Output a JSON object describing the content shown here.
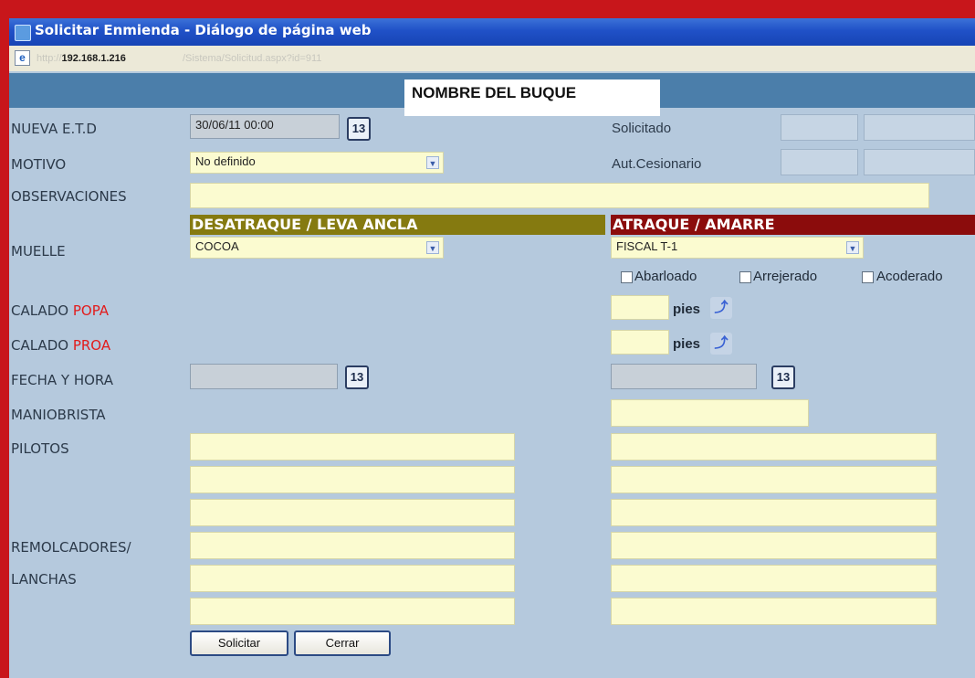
{
  "window": {
    "title": "Solicitar Enmienda - Diálogo de página web",
    "address_host": "192.168.1.216",
    "address_prefix": "http://",
    "address_path": "/Sistema/Solicitud.aspx?id=911"
  },
  "header": {
    "ship_name": "NOMBRE DEL BUQUE"
  },
  "labels": {
    "nueva_etd": "NUEVA E.T.D",
    "motivo": "MOTIVO",
    "observaciones": "OBSERVACIONES",
    "muelle": "MUELLE",
    "calado": "CALADO",
    "popa": "POPA",
    "proa": "PROA",
    "fecha_hora": "FECHA Y HORA",
    "maniobrista": "MANIOBRISTA",
    "pilotos": "PILOTOS",
    "remolcadores": "REMOLCADORES/",
    "lanchas": "LANCHAS",
    "solicitado": "Solicitado",
    "aut_cesionario": "Aut.Cesionario"
  },
  "fields": {
    "etd_value": "30/06/11 00:00",
    "motivo_value": "No definido",
    "muelle_left": "COCOA",
    "muelle_right": "FISCAL T-1",
    "calendar_icon_text": "13"
  },
  "sections": {
    "left": "DESATRAQUE / LEVA ANCLA",
    "right": "ATRAQUE / AMARRE"
  },
  "checkboxes": [
    "Abarloado",
    "Arrejerado",
    "Acoderado"
  ],
  "units": {
    "pies": "pies",
    "convert_icon": "⤴"
  },
  "buttons": {
    "solicitar": "Solicitar",
    "cerrar": "Cerrar"
  },
  "icons": {
    "calendar": "calendar-icon",
    "convert": "convert-icon",
    "dropdown": "chevron-down-icon",
    "ie": "ie-icon"
  }
}
